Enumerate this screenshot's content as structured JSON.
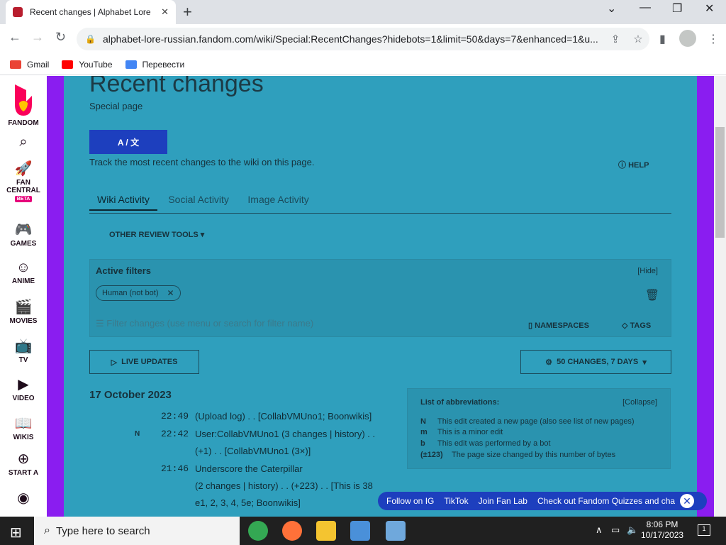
{
  "browser": {
    "tab_title": "Recent changes | Alphabet Lore",
    "url": "alphabet-lore-russian.fandom.com/wiki/Special:RecentChanges?hidebots=1&limit=50&days=7&enhanced=1&u...",
    "bookmarks": [
      {
        "label": "Gmail",
        "color": "#ea4335"
      },
      {
        "label": "YouTube",
        "color": "#ff0000"
      },
      {
        "label": "Перевести",
        "color": "#4285f4"
      }
    ]
  },
  "sidebar": {
    "logo_label": "FANDOM",
    "items": [
      {
        "label": "FAN CENTRAL",
        "badge": "BETA",
        "icon": "rocket-icon"
      },
      {
        "label": "GAMES",
        "icon": "gamepad-icon"
      },
      {
        "label": "ANIME",
        "icon": "anime-icon"
      },
      {
        "label": "MOVIES",
        "icon": "movies-icon"
      },
      {
        "label": "TV",
        "icon": "tv-icon"
      },
      {
        "label": "VIDEO",
        "icon": "video-icon"
      },
      {
        "label": "WIKIS",
        "icon": "wikis-icon"
      },
      {
        "label": "START A",
        "icon": "plus-icon"
      }
    ]
  },
  "page": {
    "title": "Recent changes",
    "subtitle": "Special page",
    "lang_button": "A / 文",
    "description": "Track the most recent changes to the wiki on this page.",
    "help": "HELP",
    "tabs": [
      "Wiki Activity",
      "Social Activity",
      "Image Activity"
    ],
    "review_tools": "OTHER REVIEW TOOLS",
    "filters": {
      "heading": "Active filters",
      "hide": "[Hide]",
      "pill": "Human (not bot)",
      "search_placeholder": "Filter changes (use menu or search for filter name)",
      "namespaces": "NAMESPACES",
      "tags": "TAGS"
    },
    "live_updates": "LIVE UPDATES",
    "changes_setting": "50 CHANGES, 7 DAYS",
    "date": "17 October 2023",
    "changes": [
      {
        "time": "22:49",
        "flag": "",
        "line1": "(Upload log) . . [CollabVMUno1; Boonwikis]",
        "line2": ""
      },
      {
        "time": "22:42",
        "flag": "N",
        "line1": "User:CollabVMUno1 (3 changes | history) . .",
        "line2": "(+1) . . [CollabVMUno1 (3×)]"
      },
      {
        "time": "21:46",
        "flag": "",
        "line1": "Underscore the Caterpillar",
        "line2": "(2 changes | history) . . (+223) . . [This is 38",
        "line3": "e1, 2, 3, 4, 5e; Boonwikis]"
      }
    ],
    "abbreviations": {
      "heading": "List of abbreviations:",
      "collapse": "[Collapse]",
      "rows": [
        {
          "key": "N",
          "text": "This edit created a new page (also see list of new pages)"
        },
        {
          "key": "m",
          "text": "This is a minor edit"
        },
        {
          "key": "b",
          "text": "This edit was performed by a bot"
        },
        {
          "key": "(±123)",
          "text": "The page size changed by this number of bytes"
        }
      ]
    },
    "social_bar": [
      "Follow on IG",
      "TikTok",
      "Join Fan Lab",
      "Check out Fandom Quizzes and cha"
    ]
  },
  "taskbar": {
    "search_placeholder": "Type here to search",
    "time": "8:06 PM",
    "date": "10/17/2023",
    "notif_count": "1"
  }
}
